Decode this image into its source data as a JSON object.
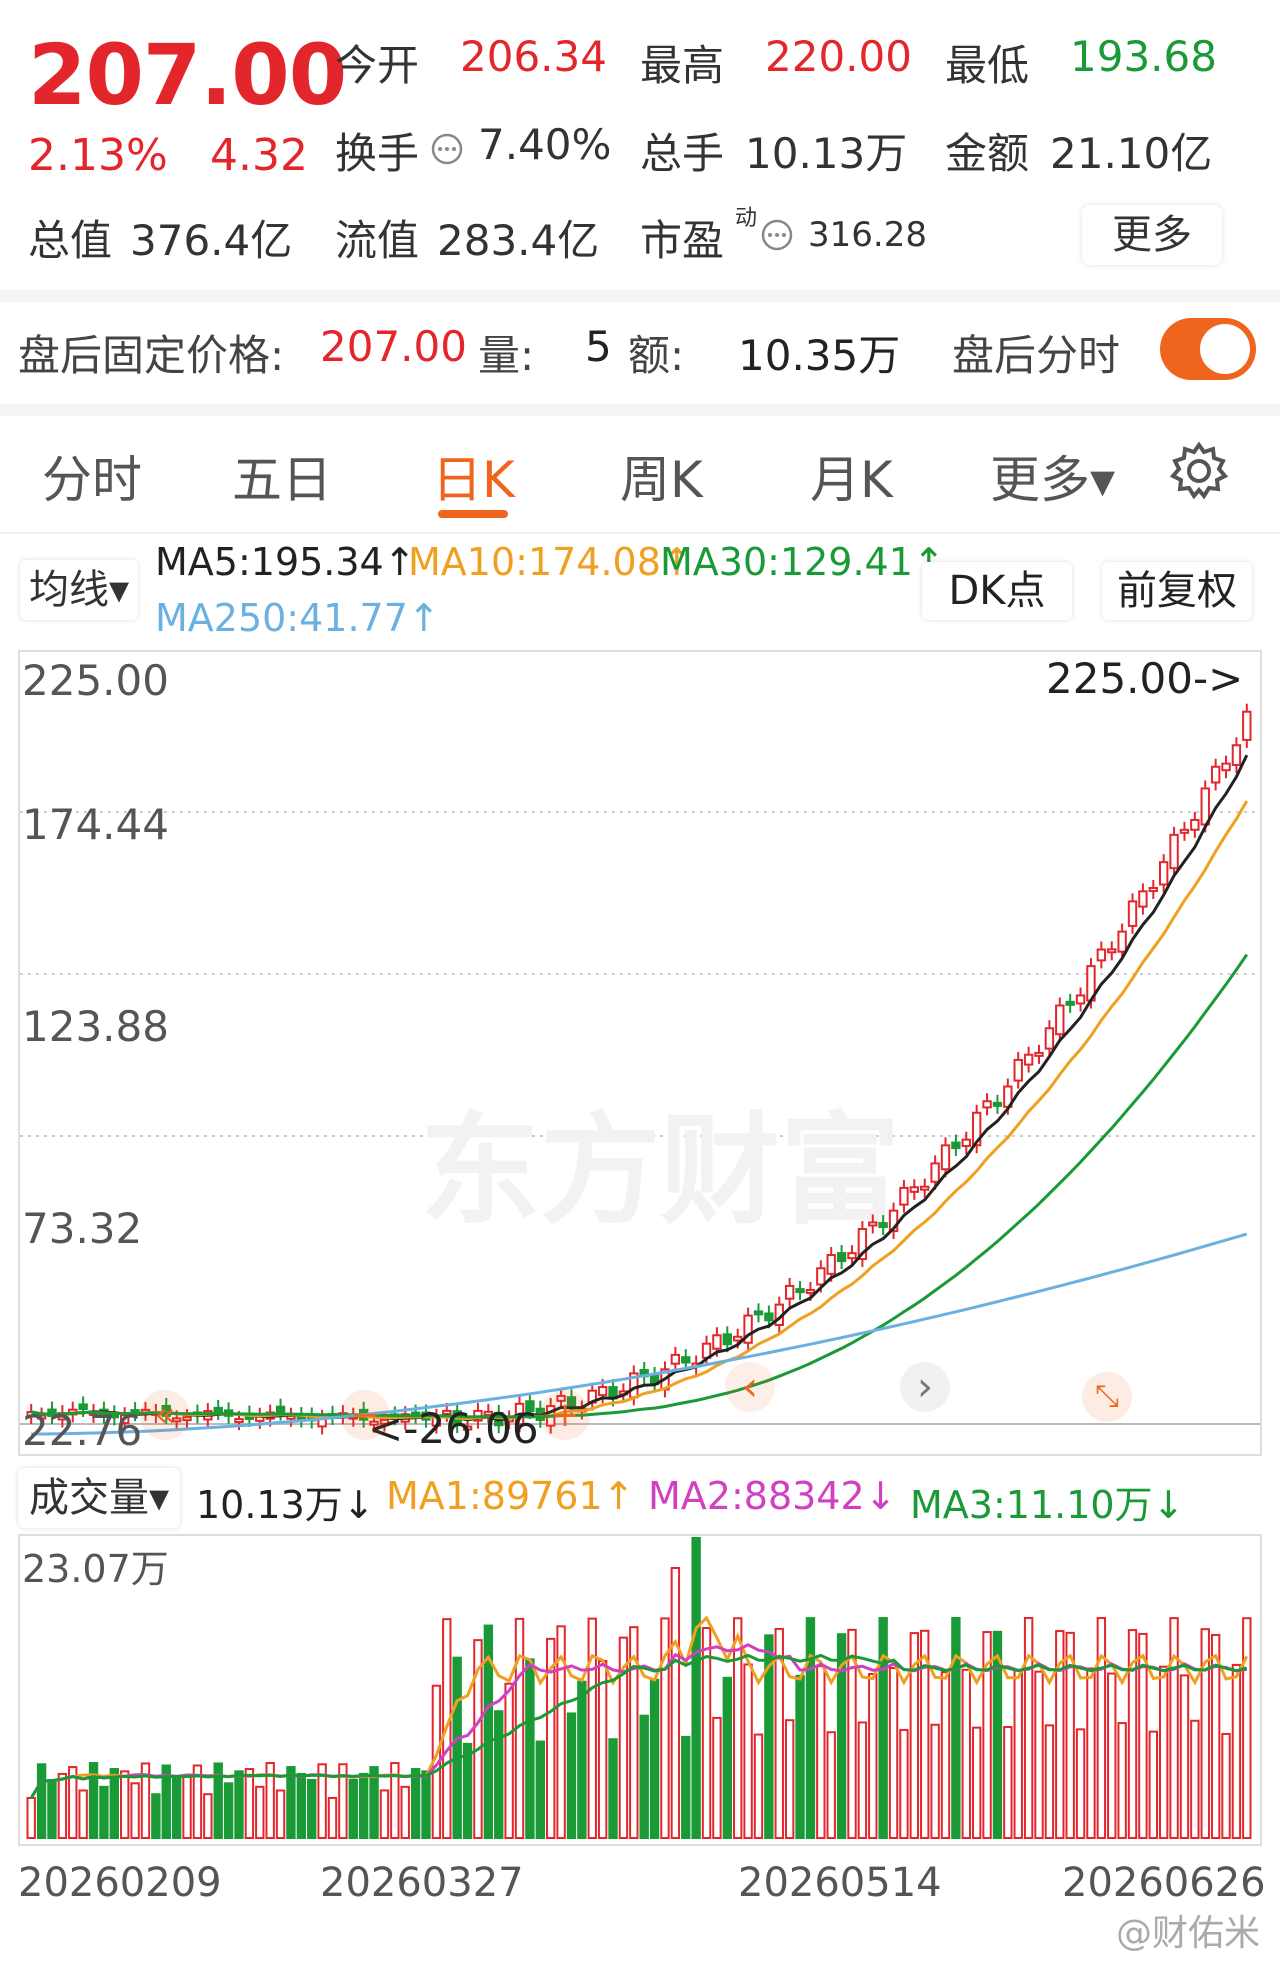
{
  "quote": {
    "price": "207.00",
    "change_pct": "2.13%",
    "change": "4.32",
    "open_label": "今开",
    "open": "206.34",
    "high_label": "最高",
    "high": "220.00",
    "low_label": "最低",
    "low": "193.68",
    "turnover_label": "换手",
    "turnover": "7.40%",
    "volume_label": "总手",
    "volume": "10.13万",
    "amount_label": "金额",
    "amount": "21.10亿",
    "total_cap_label": "总值",
    "total_cap": "376.4亿",
    "float_cap_label": "流值",
    "float_cap": "283.4亿",
    "pe_label": "市盈",
    "pe_sup": "动",
    "pe": "316.28",
    "more_button": "更多"
  },
  "after_hours": {
    "label": "盘后固定价格:",
    "price": "207.00",
    "vol_label": "量:",
    "vol": "5",
    "amt_label": "额:",
    "amt": "10.35万",
    "toggle_label": "盘后分时",
    "toggle_on": true
  },
  "tabs": [
    {
      "label": "分时"
    },
    {
      "label": "五日"
    },
    {
      "label": "日K",
      "active": true
    },
    {
      "label": "周K"
    },
    {
      "label": "月K"
    },
    {
      "label": "更多▾"
    }
  ],
  "indicators": {
    "dropdown": "均线▾",
    "ma5": "MA5:195.34↑",
    "ma10": "MA10:174.08↑",
    "ma30": "MA30:129.41↑",
    "ma250": "MA250:41.77↑",
    "dk_button": "DK点",
    "fq_button": "前复权"
  },
  "kline": {
    "y_labels": [
      "225.00",
      "174.44",
      "123.88",
      "73.32",
      "22.76"
    ],
    "max_annotation": "225.00->",
    "min_annotation": "<-26.06",
    "watermark": "东方财富"
  },
  "volume": {
    "dropdown": "成交量▾",
    "value": "10.13万↓",
    "ma1": "MA1:89761↑",
    "ma2": "MA2:88342↓",
    "ma3": "MA3:11.10万↓",
    "y_top": "23.07万"
  },
  "dates": [
    "20260209",
    "20260327",
    "20260514",
    "20260626"
  ],
  "footer_watermark": "@财佑米",
  "colors": {
    "up": "#e3262b",
    "down": "#1a9a37",
    "accent": "#f0651e",
    "ma5": "#222222",
    "ma10": "#f0a020",
    "ma30": "#1a9a37",
    "ma250": "#6ab0e0",
    "vol_ma2": "#d040c0"
  },
  "icons": [
    "settings-gear-icon",
    "info-circle-icon",
    "double-left-arrow-icon",
    "left-arrow-icon",
    "right-arrow-icon",
    "expand-icon"
  ]
}
